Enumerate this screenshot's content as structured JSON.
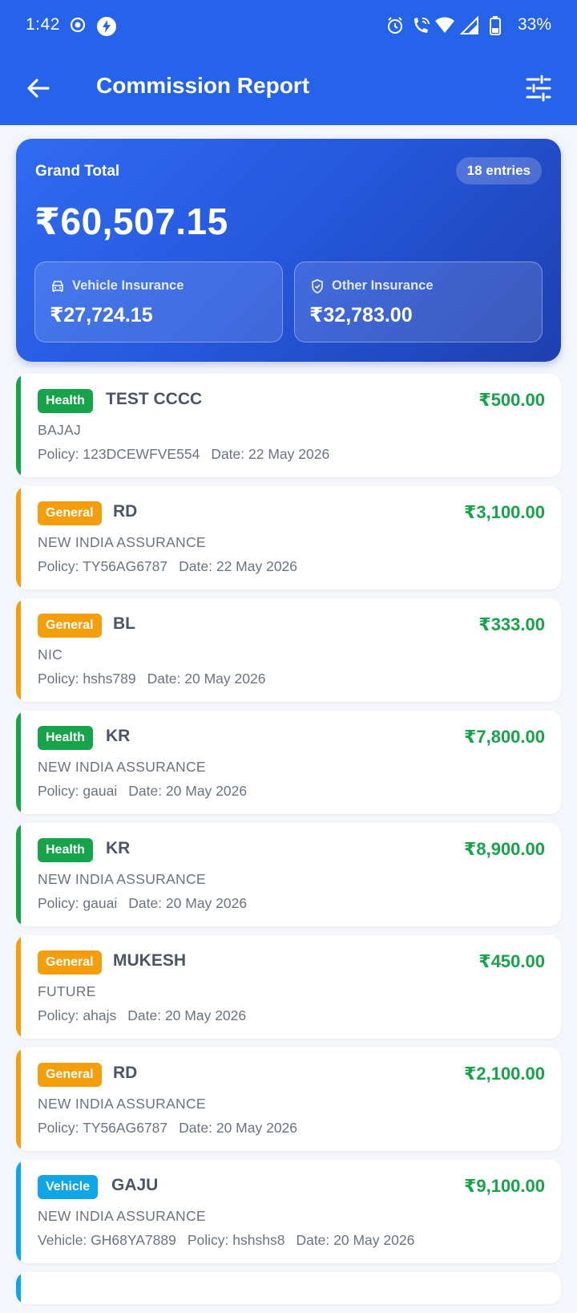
{
  "status": {
    "time": "1:42",
    "battery": "33%"
  },
  "header": {
    "title": "Commission Report"
  },
  "summary": {
    "label": "Grand Total",
    "entries": "18 entries",
    "total": "₹60,507.15",
    "vehicle_label": "Vehicle Insurance",
    "vehicle_value": "₹27,724.15",
    "other_label": "Other Insurance",
    "other_value": "₹32,783.00"
  },
  "colors": {
    "health": "#16a34a",
    "general": "#f59e0b",
    "vehicle": "#0ea5e9"
  },
  "entries": [
    {
      "type": "Health",
      "name": "TEST CCCC",
      "amount": "₹500.00",
      "company": "BAJAJ",
      "policy": "Policy: 123DCEWFVE554",
      "date": "Date: 22 May 2026"
    },
    {
      "type": "General",
      "name": "RD",
      "amount": "₹3,100.00",
      "company": "NEW INDIA ASSURANCE",
      "policy": "Policy: TY56AG6787",
      "date": "Date: 22 May 2026"
    },
    {
      "type": "General",
      "name": "BL",
      "amount": "₹333.00",
      "company": "NIC",
      "policy": "Policy: hshs789",
      "date": "Date: 20 May 2026"
    },
    {
      "type": "Health",
      "name": "KR",
      "amount": "₹7,800.00",
      "company": "NEW INDIA ASSURANCE",
      "policy": "Policy: gauai",
      "date": "Date: 20 May 2026"
    },
    {
      "type": "Health",
      "name": "KR",
      "amount": "₹8,900.00",
      "company": "NEW INDIA ASSURANCE",
      "policy": "Policy: gauai",
      "date": "Date: 20 May 2026"
    },
    {
      "type": "General",
      "name": "MUKESH",
      "amount": "₹450.00",
      "company": "FUTURE",
      "policy": "Policy: ahajs",
      "date": "Date: 20 May 2026"
    },
    {
      "type": "General",
      "name": "RD",
      "amount": "₹2,100.00",
      "company": "NEW INDIA ASSURANCE",
      "policy": "Policy: TY56AG6787",
      "date": "Date: 20 May 2026"
    },
    {
      "type": "Vehicle",
      "name": "GAJU",
      "amount": "₹9,100.00",
      "company": "NEW INDIA ASSURANCE",
      "vehicle": "Vehicle: GH68YA7889",
      "policy": "Policy: hshshs8",
      "date": "Date: 20 May 2026"
    }
  ]
}
